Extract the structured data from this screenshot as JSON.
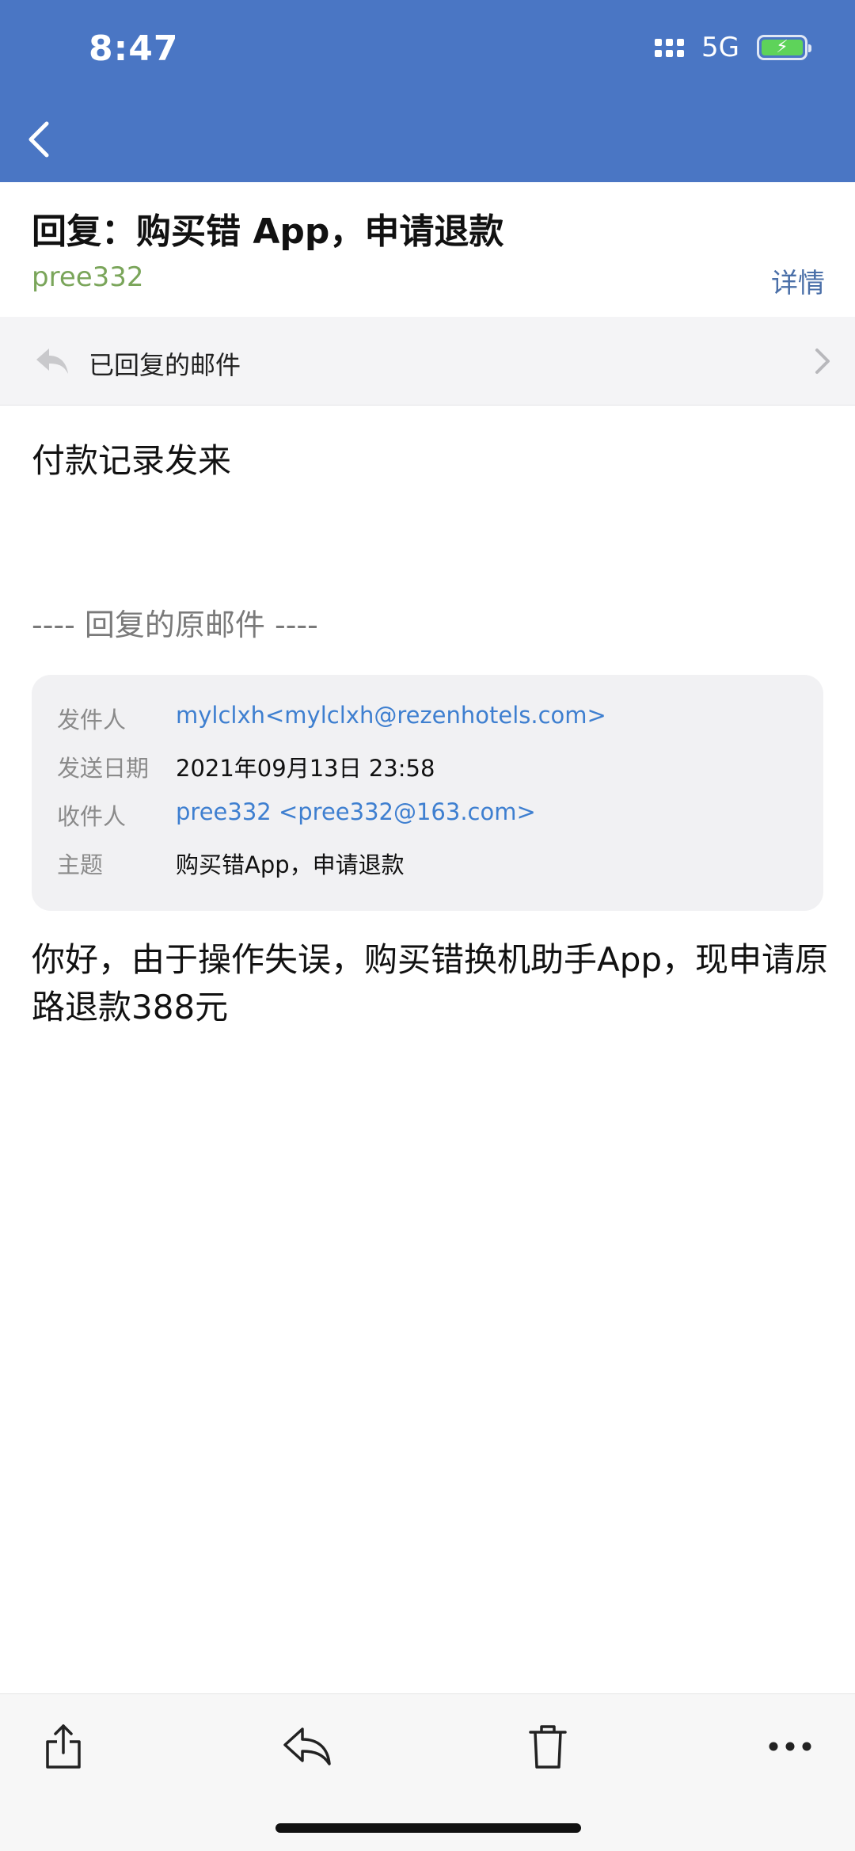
{
  "status_bar": {
    "time": "8:47",
    "network": "5G"
  },
  "header": {
    "back_icon": "chevron-left-icon"
  },
  "email": {
    "subject": "回复：购买错 App，申请退款",
    "sender": "pree332",
    "details_label": "详情"
  },
  "replied_bar": {
    "label": "已回复的邮件",
    "icon": "reply-icon"
  },
  "body": {
    "reply_text": "付款记录发来",
    "quote_divider": "---- 回复的原邮件 ----",
    "original_text": "你好，由于操作失误，购买错换机助手App，现申请原路退款388元"
  },
  "original_mail": {
    "from_label": "发件人",
    "from_value": "mylclxh<mylclxh@rezenhotels.com>",
    "date_label": "发送日期",
    "date_value": "2021年09月13日 23:58",
    "to_label": "收件人",
    "to_value": "pree332 <pree332@163.com>",
    "subject_label": "主题",
    "subject_value": "购买错App，申请退款"
  },
  "toolbar": {
    "share_icon": "share-icon",
    "reply_icon": "reply-icon",
    "delete_icon": "trash-icon",
    "more_icon": "more-icon"
  },
  "colors": {
    "header_bg": "#4a76c4",
    "sender": "#7aa55a",
    "link": "#3e7fd0",
    "details": "#4a6fa8"
  }
}
